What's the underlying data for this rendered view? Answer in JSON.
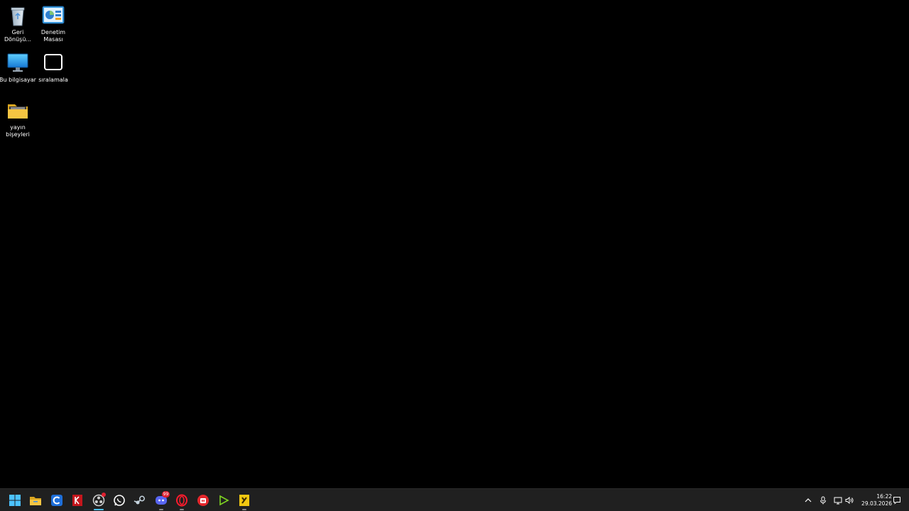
{
  "desktop": {
    "icons": [
      {
        "label": "Geri\nDönüşü...",
        "icon": "recycle-bin-icon"
      },
      {
        "label": "Denetim\nMasası",
        "icon": "control-panel-icon"
      },
      {
        "label": "Bu bilgisayar",
        "icon": "this-pc-icon"
      },
      {
        "label": "sıralamala",
        "icon": "shortcut-window-icon"
      },
      {
        "label": "yayın\nbişeyleri",
        "icon": "folder-icon"
      }
    ]
  },
  "taskbar": {
    "apps": [
      {
        "name": "start",
        "icon": "windows-start-icon",
        "color": "#4cc2ff"
      },
      {
        "name": "file-explorer",
        "icon": "folder-icon",
        "color": "#f5c542"
      },
      {
        "name": "app-blue-c",
        "icon": "app-c-icon",
        "color": "#1e6fd9"
      },
      {
        "name": "app-red",
        "icon": "app-red-icon",
        "color": "#c4161c"
      },
      {
        "name": "obs",
        "icon": "obs-icon",
        "color": "#ffffff",
        "active": true
      },
      {
        "name": "whatsapp",
        "icon": "whatsapp-icon",
        "color": "#25d366"
      },
      {
        "name": "steam",
        "icon": "steam-icon",
        "color": "#c7d5e0"
      },
      {
        "name": "discord",
        "icon": "discord-icon",
        "color": "#5865f2",
        "badge": "99"
      },
      {
        "name": "opera",
        "icon": "opera-icon",
        "color": "#ff1b2d"
      },
      {
        "name": "app-red-round",
        "icon": "app-red-round-icon",
        "color": "#e4262b"
      },
      {
        "name": "play",
        "icon": "play-icon",
        "color": "#7ed321"
      },
      {
        "name": "app-yellow",
        "icon": "app-yellow-icon",
        "color": "#f2c811"
      }
    ]
  },
  "tray": {
    "icons": [
      "chevron-up-icon",
      "microphone-icon",
      "network-icon",
      "speaker-icon"
    ],
    "time": "16:22",
    "date": "29.03.2026",
    "notification_icon": "notification-icon"
  }
}
